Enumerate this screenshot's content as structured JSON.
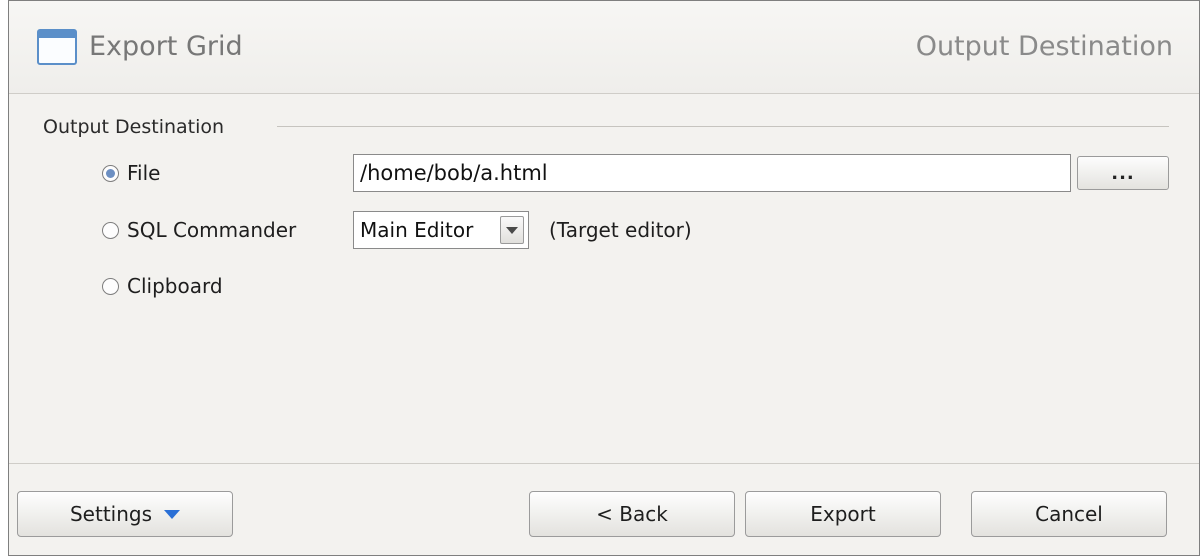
{
  "header": {
    "title": "Export Grid",
    "step_title": "Output Destination",
    "icon": "window-icon"
  },
  "output_group": {
    "label": "Output Destination",
    "options": [
      {
        "label": "File",
        "checked": true
      },
      {
        "label": "SQL Commander",
        "checked": false
      },
      {
        "label": "Clipboard",
        "checked": false
      }
    ],
    "file_path": "/home/bob/a.html",
    "browse_label": "...",
    "editor_select_value": "Main Editor",
    "target_note": "(Target editor)"
  },
  "footer": {
    "settings_label": "Settings",
    "back_label": "< Back",
    "export_label": "Export",
    "cancel_label": "Cancel"
  },
  "colors": {
    "accent_blue": "#2a6fd6",
    "icon_blue": "#5b8fc9",
    "dialog_bg": "#f3f2ef"
  }
}
